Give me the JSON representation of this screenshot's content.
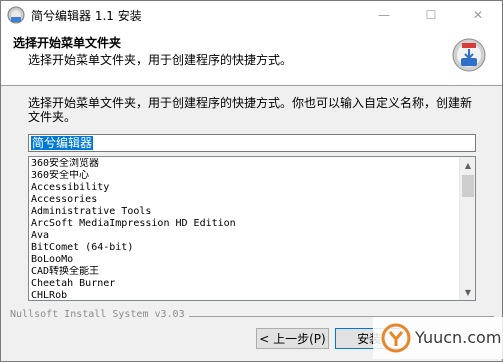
{
  "window": {
    "title": "简兮编辑器 1.1 安装",
    "controls": {
      "minimize": "—",
      "maximize": "☐",
      "close": "✕"
    }
  },
  "header": {
    "title": "选择开始菜单文件夹",
    "subtitle": "选择开始菜单文件夹，用于创建程序的快捷方式。"
  },
  "body": {
    "intro": "选择开始菜单文件夹，用于创建程序的快捷方式。你也可以输入自定义名称，创建新文件夹。"
  },
  "folder_input": {
    "value": "简兮编辑器"
  },
  "folder_list": {
    "items": [
      "360安全浏览器",
      "360安全中心",
      "Accessibility",
      "Accessories",
      "Administrative Tools",
      "ArcSoft MediaImpression HD Edition",
      "Ava",
      "BitComet (64-bit)",
      "BoLooMo",
      "CAD转换全能王",
      "Cheetah Burner",
      "CHLRob"
    ],
    "scroll_position": 0
  },
  "footer": {
    "branding": "Nullsoft Install System v3.03",
    "back_label": "< 上一步(P)",
    "install_label": "安装("
  },
  "watermark": {
    "text": "Yuucn.com"
  },
  "colors": {
    "selection": "#0078d7",
    "window_bg": "#f0f0f0",
    "header_bg": "#ffffff",
    "watermark_accent": "#e8862a"
  },
  "icons": {
    "app": "installer-app-icon",
    "header": "installer-disk-icon",
    "watermark": "watermark-logo-icon"
  }
}
